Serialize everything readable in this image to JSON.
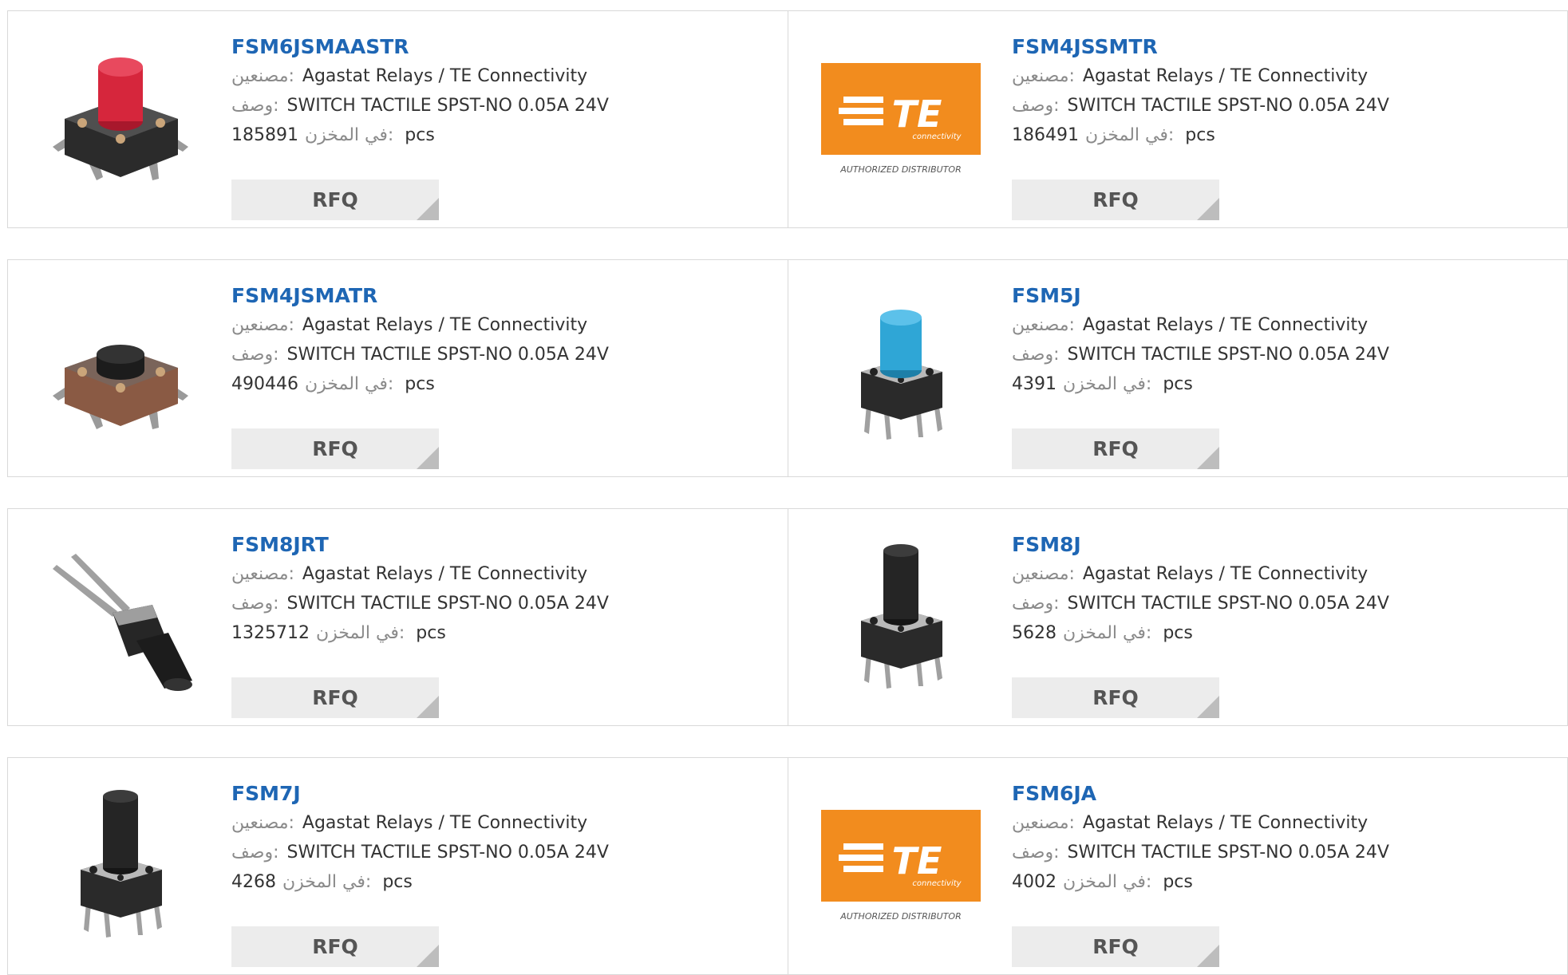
{
  "labels": {
    "manufacturer": "مصنعين:",
    "description": "وصف:",
    "in_stock": "في المخزن:",
    "units": "pcs",
    "rfq": "RFQ"
  },
  "logo": {
    "brand": "TE",
    "sub": "connectivity",
    "tagline": "AUTHORIZED DISTRIBUTOR",
    "color": "#f28c1e"
  },
  "products": [
    {
      "part": "FSM6JSMAASTR",
      "manufacturer": "Agastat Relays / TE Connectivity",
      "description": "SWITCH TACTILE SPST-NO 0.05A 24V",
      "stock": "185891",
      "image": "tactile-switch-red-icon"
    },
    {
      "part": "FSM4JSSMTR",
      "manufacturer": "Agastat Relays / TE Connectivity",
      "description": "SWITCH TACTILE SPST-NO 0.05A 24V",
      "stock": "186491",
      "image": "te-logo"
    },
    {
      "part": "FSM4JSMATR",
      "manufacturer": "Agastat Relays / TE Connectivity",
      "description": "SWITCH TACTILE SPST-NO 0.05A 24V",
      "stock": "490446",
      "image": "tactile-switch-brown-icon"
    },
    {
      "part": "FSM5J",
      "manufacturer": "Agastat Relays / TE Connectivity",
      "description": "SWITCH TACTILE SPST-NO 0.05A 24V",
      "stock": "4391",
      "image": "tactile-switch-blue-icon"
    },
    {
      "part": "FSM8JRT",
      "manufacturer": "Agastat Relays / TE Connectivity",
      "description": "SWITCH TACTILE SPST-NO 0.05A 24V",
      "stock": "1325712",
      "image": "tactile-switch-right-angle-icon"
    },
    {
      "part": "FSM8J",
      "manufacturer": "Agastat Relays / TE Connectivity",
      "description": "SWITCH TACTILE SPST-NO 0.05A 24V",
      "stock": "5628",
      "image": "tactile-switch-tall-icon"
    },
    {
      "part": "FSM7J",
      "manufacturer": "Agastat Relays / TE Connectivity",
      "description": "SWITCH TACTILE SPST-NO 0.05A 24V",
      "stock": "4268",
      "image": "tactile-switch-tall-icon"
    },
    {
      "part": "FSM6JA",
      "manufacturer": "Agastat Relays / TE Connectivity",
      "description": "SWITCH TACTILE SPST-NO 0.05A 24V",
      "stock": "4002",
      "image": "te-logo"
    }
  ]
}
